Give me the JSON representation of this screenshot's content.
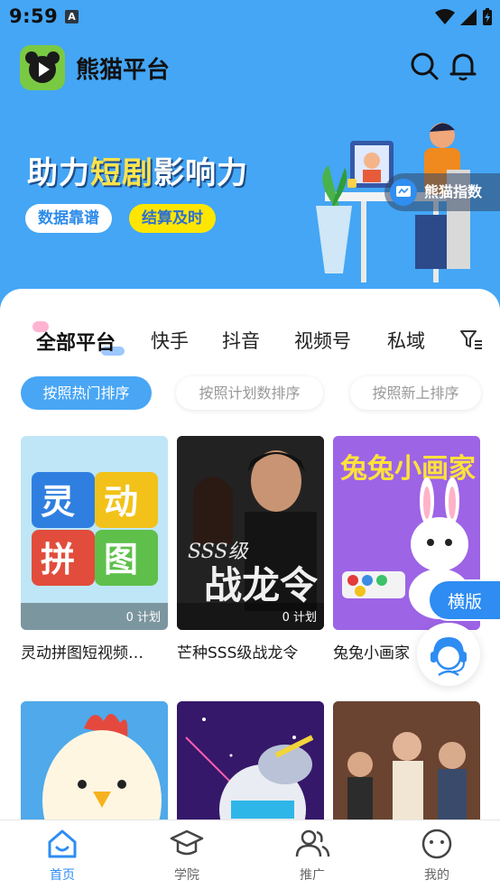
{
  "status": {
    "time": "9:59",
    "notification_glyph": "A"
  },
  "header": {
    "title": "熊猫平台"
  },
  "banner": {
    "slogan_part1": "助力",
    "slogan_highlight": "短剧",
    "slogan_part2": "影响力",
    "pill_left": "数据靠谱",
    "pill_right": "结算及时",
    "badge": "熊猫指数"
  },
  "tabs": [
    "全部平台",
    "快手",
    "抖音",
    "视频号",
    "私域"
  ],
  "sorts": [
    "按照热门排序",
    "按照计划数排序",
    "按照新上排序"
  ],
  "cards": [
    {
      "title": "灵动拼图短视频…",
      "plans": "0 计划",
      "thumb_text": "灵动拼图"
    },
    {
      "title": "芒种SSS级战龙令",
      "plans": "0 计划",
      "thumb_text": "SSS级 战龙令"
    },
    {
      "title": "兔兔小画家",
      "plans": "",
      "thumb_text": "兔兔小画家"
    }
  ],
  "floats": {
    "landscape": "横版"
  },
  "bottom_nav": [
    {
      "label": "首页",
      "icon": "home-icon"
    },
    {
      "label": "学院",
      "icon": "graduation-cap-icon"
    },
    {
      "label": "推广",
      "icon": "users-icon"
    },
    {
      "label": "我的",
      "icon": "smiley-icon"
    }
  ],
  "colors": {
    "brand_blue": "#44a6f5",
    "active_blue": "#2e8cf2",
    "highlight_yellow": "#ffe34a"
  }
}
